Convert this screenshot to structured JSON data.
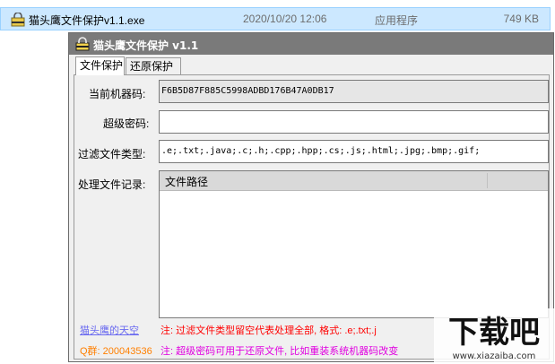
{
  "file": {
    "name": "猫头鹰文件保护v1.1.exe",
    "date": "2020/10/20 12:06",
    "type": "应用程序",
    "size": "749 KB",
    "icon": "exe-app-icon"
  },
  "window": {
    "title": "猫头鹰文件保护 v1.1",
    "icon": "app-lock-icon"
  },
  "tabs": [
    {
      "label": "文件保护",
      "active": true
    },
    {
      "label": "还原保护",
      "active": false
    }
  ],
  "form": {
    "machine_code_label": "当前机器码:",
    "machine_code_value": "F6B5D87F885C5998ADBD176B47A0DB17",
    "super_password_label": "超级密码:",
    "super_password_value": "",
    "filter_label": "过滤文件类型:",
    "filter_value": ".e;.txt;.java;.c;.h;.cpp;.hpp;.cs;.js;.html;.jpg;.bmp;.gif;",
    "records_label": "处理文件记录:",
    "records_columns": [
      "文件路径"
    ],
    "records_rows": []
  },
  "footer": {
    "link_text": "猫头鹰的天空",
    "qq_text": "Q群: 200043536",
    "note1": "注: 过滤文件类型留空代表处理全部, 格式: .e;.txt;.j",
    "note2": "注: 超级密码可用于还原文件, 比如重装系统机器码改变"
  },
  "watermark": {
    "text": "下载吧",
    "url_text": "www.xiazaiba.com"
  },
  "colors": {
    "selection_bg": "#cce8ff",
    "titlebar": "#7a7a7a",
    "link": "#6a6af0",
    "qq": "#ff7f00",
    "note_red": "#ff0000",
    "note_magenta": "#e000e0"
  }
}
